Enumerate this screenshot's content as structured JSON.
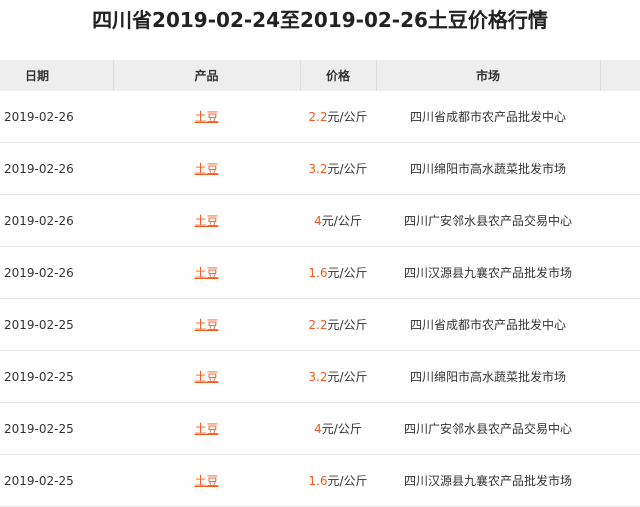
{
  "page": {
    "title": "四川省2019-02-24至2019-02-26土豆价格行情"
  },
  "table": {
    "headers": {
      "date": "日期",
      "product": "产品",
      "price": "价格",
      "market": "市场"
    },
    "rows": [
      {
        "date": "2019-02-26",
        "product": "土豆",
        "price": "2.2",
        "unit": "元/公斤",
        "market": "四川省成都市农产品批发中心"
      },
      {
        "date": "2019-02-26",
        "product": "土豆",
        "price": "3.2",
        "unit": "元/公斤",
        "market": "四川绵阳市高水蔬菜批发市场"
      },
      {
        "date": "2019-02-26",
        "product": "土豆",
        "price": "4",
        "unit": "元/公斤",
        "market": "四川广安邻水县农产品交易中心"
      },
      {
        "date": "2019-02-26",
        "product": "土豆",
        "price": "1.6",
        "unit": "元/公斤",
        "market": "四川汉源县九襄农产品批发市场"
      },
      {
        "date": "2019-02-25",
        "product": "土豆",
        "price": "2.2",
        "unit": "元/公斤",
        "market": "四川省成都市农产品批发中心"
      },
      {
        "date": "2019-02-25",
        "product": "土豆",
        "price": "3.2",
        "unit": "元/公斤",
        "market": "四川绵阳市高水蔬菜批发市场"
      },
      {
        "date": "2019-02-25",
        "product": "土豆",
        "price": "4",
        "unit": "元/公斤",
        "market": "四川广安邻水县农产品交易中心"
      },
      {
        "date": "2019-02-25",
        "product": "土豆",
        "price": "1.6",
        "unit": "元/公斤",
        "market": "四川汉源县九襄农产品批发市场"
      }
    ]
  },
  "colors": {
    "accent": "#f05a23",
    "header_bg": "#eeeeee"
  }
}
